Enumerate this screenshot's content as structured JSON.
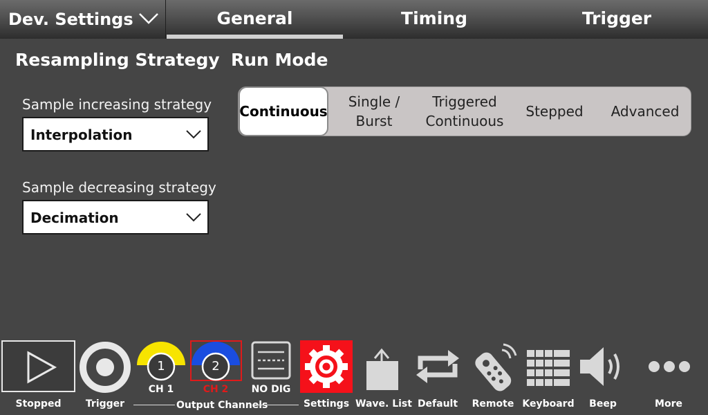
{
  "header": {
    "dev_settings": "Dev. Settings",
    "tabs": [
      "General",
      "Timing",
      "Trigger"
    ],
    "active_tab": "General"
  },
  "resampling": {
    "title": "Resampling Strategy",
    "increase_label": "Sample increasing strategy",
    "increase_value": "Interpolation",
    "decrease_label": "Sample decreasing strategy",
    "decrease_value": "Decimation"
  },
  "run_mode": {
    "title": "Run Mode",
    "options": [
      {
        "line1": "Continuous",
        "line2": ""
      },
      {
        "line1": "Single /",
        "line2": "Burst"
      },
      {
        "line1": "Triggered",
        "line2": "Continuous"
      },
      {
        "line1": "Stepped",
        "line2": ""
      },
      {
        "line1": "Advanced",
        "line2": ""
      }
    ],
    "active": "Continuous"
  },
  "toolbar": {
    "stopped": "Stopped",
    "trigger": "Trigger",
    "ch1": "CH 1",
    "ch1_num": "1",
    "ch2": "CH 2",
    "ch2_num": "2",
    "no_dig": "NO DIG",
    "output_channels": "Output Channels",
    "settings": "Settings",
    "wave_list": "Wave. List",
    "default": "Default",
    "remote": "Remote",
    "keyboard": "Keyboard",
    "beep": "Beep",
    "more": "More"
  },
  "colors": {
    "ch1": "#f7e400",
    "ch2": "#1a4de0",
    "ch2_label": "#e01a1a",
    "settings_bg": "#f5111a"
  }
}
